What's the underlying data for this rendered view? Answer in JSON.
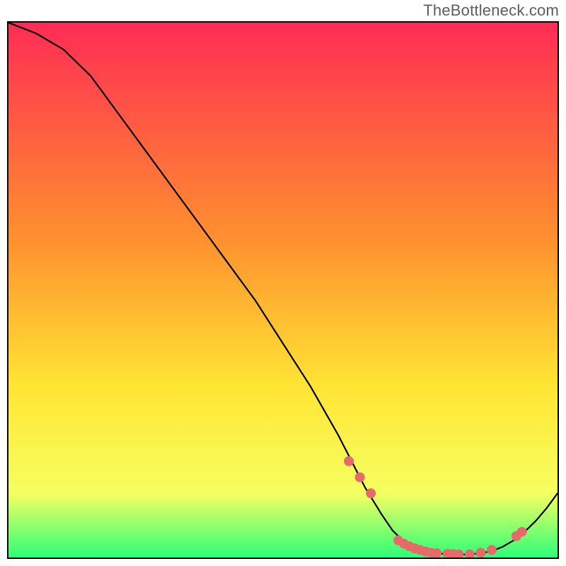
{
  "watermark": "TheBottleneck.com",
  "colors": {
    "gradient_top": "#ff2c55",
    "gradient_mid1": "#ff8f2f",
    "gradient_mid2": "#ffe534",
    "gradient_mid3": "#f6ff62",
    "gradient_bottom": "#2dff77",
    "curve": "#000000",
    "marker_fill": "#e66a6a",
    "marker_stroke": "#c74f4f",
    "frame": "#000000"
  },
  "chart_data": {
    "type": "line",
    "title": "",
    "xlabel": "",
    "ylabel": "",
    "xlim": [
      0,
      100
    ],
    "ylim": [
      0,
      100
    ],
    "grid": false,
    "legend": false,
    "series": [
      {
        "name": "curve",
        "x": [
          0,
          5,
          10,
          15,
          20,
          25,
          30,
          35,
          40,
          45,
          50,
          55,
          60,
          62,
          65,
          68,
          70,
          72,
          74,
          76,
          78,
          80,
          82,
          84,
          86,
          88,
          90,
          92,
          94,
          96,
          98,
          100
        ],
        "y": [
          100,
          98,
          95,
          90,
          83,
          76,
          69,
          62,
          55,
          48,
          40,
          32,
          23,
          19,
          13,
          8,
          5,
          3,
          2,
          1,
          0.8,
          0.6,
          0.5,
          0.6,
          0.8,
          1.2,
          2.0,
          3.2,
          4.8,
          6.8,
          9.2,
          12
        ]
      }
    ],
    "markers": {
      "name": "dots",
      "x": [
        62,
        64,
        66,
        71,
        72,
        73,
        74,
        75,
        76,
        77,
        78,
        80,
        81,
        82,
        84,
        86,
        88,
        92.5,
        93.5
      ],
      "y": [
        18,
        15,
        12,
        3.2,
        2.6,
        2.1,
        1.7,
        1.4,
        1.1,
        0.9,
        0.8,
        0.7,
        0.65,
        0.6,
        0.6,
        0.9,
        1.4,
        4.0,
        4.8
      ]
    }
  }
}
